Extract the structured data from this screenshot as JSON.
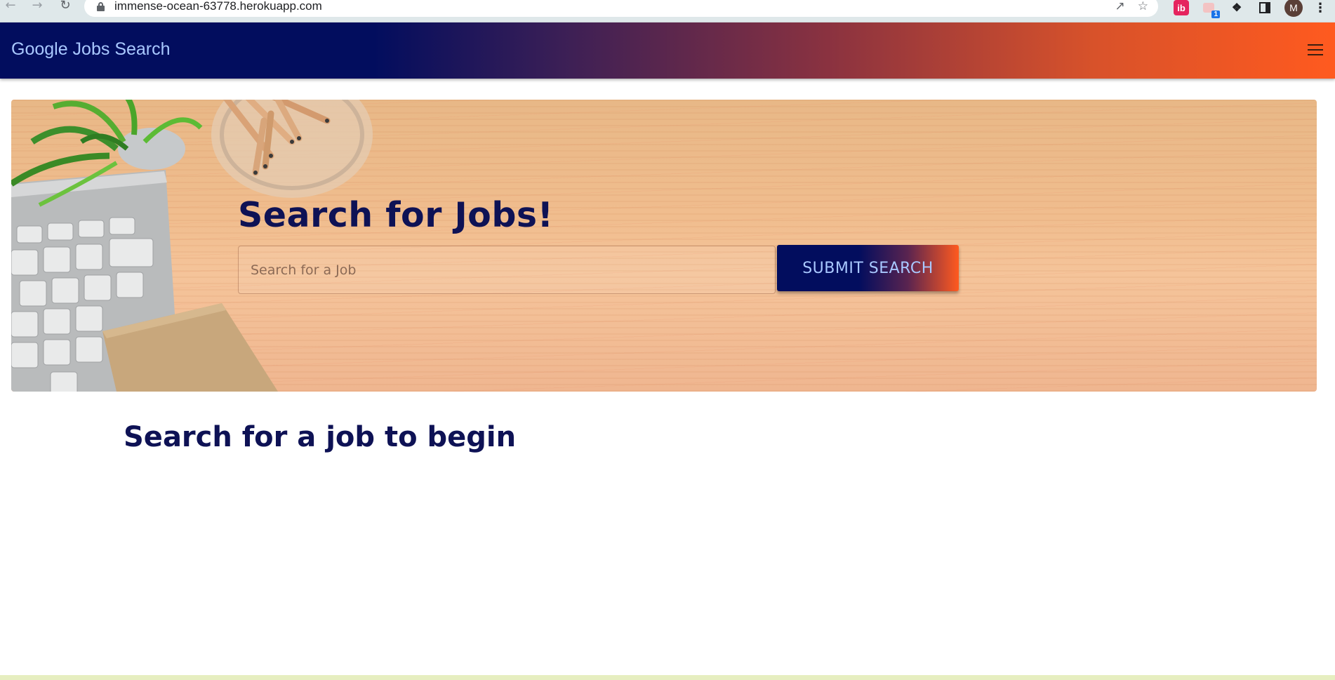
{
  "browser": {
    "url": "immense-ocean-63778.herokuapp.com",
    "avatar_letter": "M",
    "ext_ib_label": "ib",
    "ext_badge_count": "1"
  },
  "navbar": {
    "brand": "Google Jobs Search",
    "gradient_start": "#020d5e",
    "gradient_end": "#ff5a1f"
  },
  "hero": {
    "title": "Search for Jobs!",
    "search_placeholder": "Search for a Job",
    "search_value": "",
    "submit_label": "SUBMIT SEARCH"
  },
  "main": {
    "message": "Search for a job to begin"
  }
}
